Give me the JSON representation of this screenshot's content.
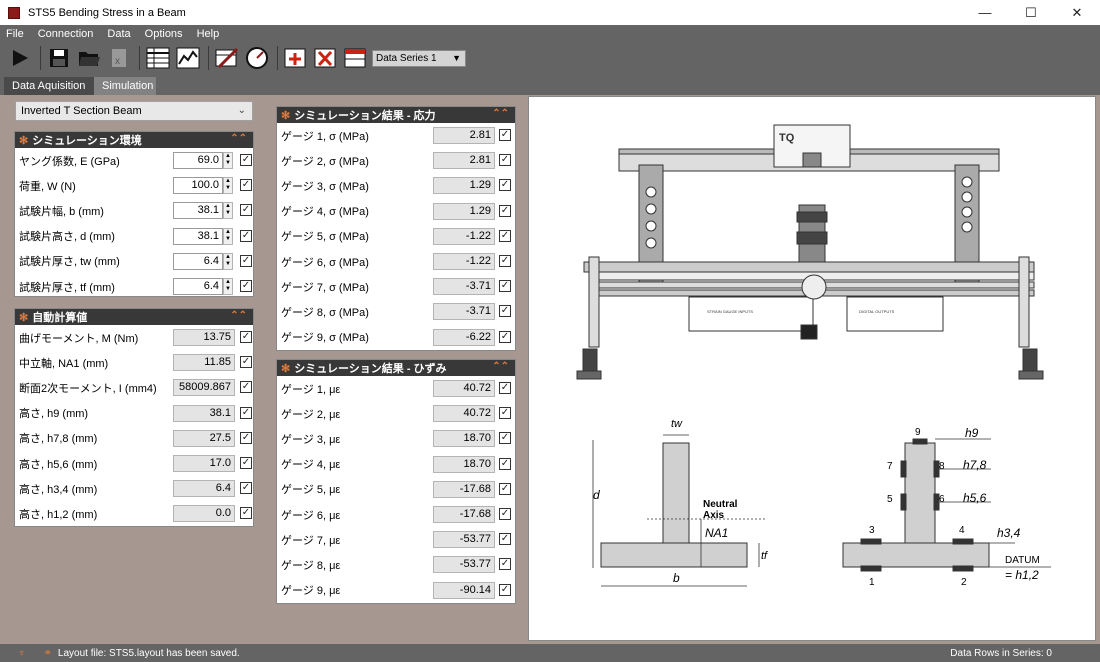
{
  "window": {
    "title": "STS5 Bending Stress in a Beam"
  },
  "menu": [
    "File",
    "Connection",
    "Data",
    "Options",
    "Help"
  ],
  "toolbar": {
    "series": "Data Series 1"
  },
  "tabs": [
    "Data Aquisition",
    "Simulation"
  ],
  "left": {
    "dropdown": "Inverted T Section Beam",
    "env": {
      "title": "シミュレーション環境",
      "rows": [
        {
          "label": "ヤング係数, E (GPa)",
          "value": "69.0"
        },
        {
          "label": "荷重, W (N)",
          "value": "100.0"
        },
        {
          "label": "試験片幅, b (mm)",
          "value": "38.1"
        },
        {
          "label": "試験片高さ, d (mm)",
          "value": "38.1"
        },
        {
          "label": "試験片厚さ, tw (mm)",
          "value": "6.4"
        },
        {
          "label": "試験片厚さ, tf (mm)",
          "value": "6.4"
        }
      ]
    },
    "auto": {
      "title": "自動計算値",
      "rows": [
        {
          "label": "曲げモーメント, M (Nm)",
          "value": "13.75"
        },
        {
          "label": "中立軸, NA1 (mm)",
          "value": "11.85"
        },
        {
          "label": "断面2次モーメント, I (mm4)",
          "value": "58009.867"
        },
        {
          "label": "高さ, h9 (mm)",
          "value": "38.1"
        },
        {
          "label": "高さ, h7,8 (mm)",
          "value": "27.5"
        },
        {
          "label": "高さ, h5,6 (mm)",
          "value": "17.0"
        },
        {
          "label": "高さ, h3,4 (mm)",
          "value": "6.4"
        },
        {
          "label": "高さ, h1,2 (mm)",
          "value": "0.0"
        }
      ]
    }
  },
  "mid": {
    "stress": {
      "title": "シミュレーション結果 - 応力",
      "rows": [
        {
          "label": "ゲージ 1, σ (MPa)",
          "value": "2.81"
        },
        {
          "label": "ゲージ 2, σ (MPa)",
          "value": "2.81"
        },
        {
          "label": "ゲージ 3, σ (MPa)",
          "value": "1.29"
        },
        {
          "label": "ゲージ 4, σ (MPa)",
          "value": "1.29"
        },
        {
          "label": "ゲージ 5, σ (MPa)",
          "value": "-1.22"
        },
        {
          "label": "ゲージ 6, σ (MPa)",
          "value": "-1.22"
        },
        {
          "label": "ゲージ 7, σ (MPa)",
          "value": "-3.71"
        },
        {
          "label": "ゲージ 8, σ (MPa)",
          "value": "-3.71"
        },
        {
          "label": "ゲージ 9, σ (MPa)",
          "value": "-6.22"
        }
      ]
    },
    "strain": {
      "title": "シミュレーション結果 - ひずみ",
      "rows": [
        {
          "label": "ゲージ 1, με",
          "value": "40.72"
        },
        {
          "label": "ゲージ 2, με",
          "value": "40.72"
        },
        {
          "label": "ゲージ 3, με",
          "value": "18.70"
        },
        {
          "label": "ゲージ 4, με",
          "value": "18.70"
        },
        {
          "label": "ゲージ 5, με",
          "value": "-17.68"
        },
        {
          "label": "ゲージ 6, με",
          "value": "-17.68"
        },
        {
          "label": "ゲージ 7, με",
          "value": "-53.77"
        },
        {
          "label": "ゲージ 8, με",
          "value": "-53.77"
        },
        {
          "label": "ゲージ 9, με",
          "value": "-90.14"
        }
      ]
    }
  },
  "drawing": {
    "labels": {
      "tw": "tw",
      "d": "d",
      "tf": "tf",
      "b": "b",
      "na1": "NA1",
      "neutral": "Neutral",
      "axis": "Axis",
      "h9": "h9",
      "h78": "h7,8",
      "h56": "h5,6",
      "h34": "h3,4",
      "datum": "DATUM",
      "h12": "= h1,2",
      "g1": "1",
      "g2": "2",
      "g3": "3",
      "g4": "4",
      "g5": "5",
      "g6": "6",
      "g7": "7",
      "g8": "8",
      "g9": "9",
      "tq": "TQ",
      "dig": "DIGITAL OUTPUTS",
      "sgi": "STRAIN GAUGE INPUTS"
    }
  },
  "status": {
    "left": "Layout file: STS5.layout has been saved.",
    "right": "Data Rows in Series: 0"
  }
}
